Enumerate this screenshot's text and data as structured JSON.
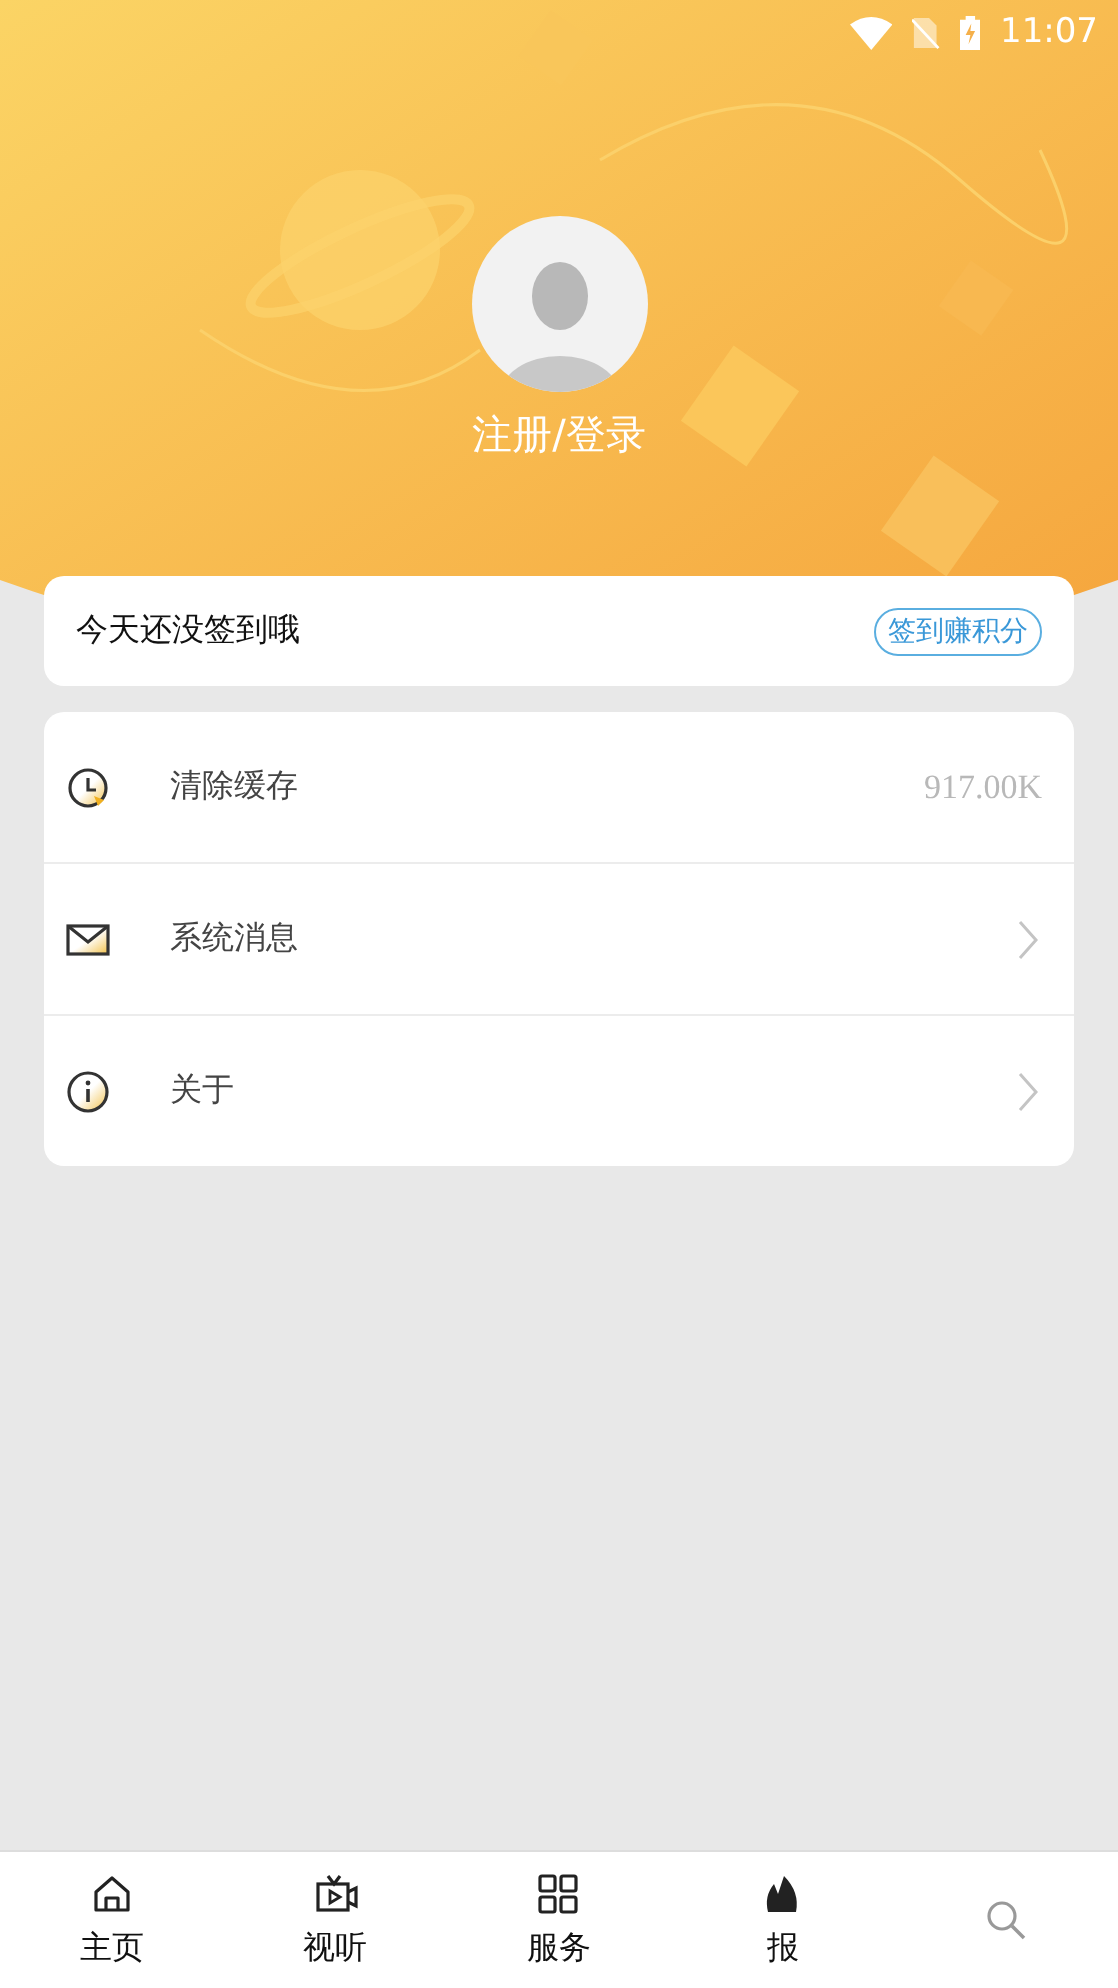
{
  "status_bar": {
    "time": "11:07"
  },
  "profile": {
    "login_label": "注册/登录"
  },
  "checkin": {
    "message": "今天还没签到哦",
    "button": "签到赚积分"
  },
  "menu": [
    {
      "kind": "value",
      "label": "清除缓存",
      "value": "917.00K"
    },
    {
      "kind": "arrow",
      "label": "系统消息"
    },
    {
      "kind": "arrow",
      "label": "关于"
    }
  ],
  "tab_bar": [
    {
      "kind": "labeled",
      "label": "主页"
    },
    {
      "kind": "labeled",
      "label": "视听"
    },
    {
      "kind": "labeled",
      "label": "服务"
    },
    {
      "kind": "labeled",
      "label": "报"
    },
    {
      "kind": "icon_only"
    }
  ]
}
